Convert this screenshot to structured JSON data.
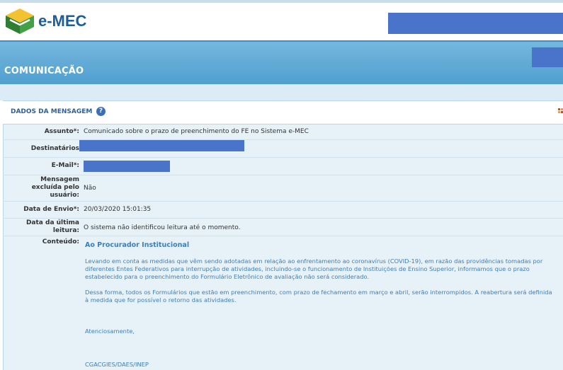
{
  "header": {
    "brand": "e-MEC",
    "colors": {
      "brand": "#1f5d98",
      "band": "#5ba6d4",
      "redaction": "#4a74c9"
    }
  },
  "page": {
    "title": "COMUNICAÇÃO"
  },
  "panel": {
    "title": "DADOS DA MENSAGEM",
    "help_icon": "?",
    "fields": [
      {
        "label": "Assunto*:",
        "value": "Comunicado sobre o prazo de preenchimento do FE no Sistema e-MEC"
      },
      {
        "label": "Destinatários",
        "value": ""
      },
      {
        "label": "E-Mail*:",
        "value": ""
      },
      {
        "label_lines": [
          "Mensagem",
          "excluída pelo",
          "usuário:"
        ],
        "value": "Não"
      },
      {
        "label": "Data de Envio*:",
        "value": "20/03/2020 15:01:35"
      },
      {
        "label_lines": [
          "Data da última",
          "leitura:"
        ],
        "value": "O sistema não identificou leitura até o momento."
      },
      {
        "label": "Conteúdo:"
      }
    ]
  },
  "message": {
    "title": "Ao Procurador Institucional",
    "paragraph1_line1": "Levando em conta as medidas que vêm sendo adotadas em relação ao enfrentamento ao coronavírus (COVID-19), em razão das providências tomadas por",
    "paragraph1_line2": "diferentes Entes Federativos para interrupção de atividades, incluindo-se o funcionamento de Instituições de Ensino Superior, informamos que o prazo",
    "paragraph1_line3": "estabelecido para o preenchimento do Formulário Eletrônico de avaliação não será considerado.",
    "paragraph2_line1": "Dessa forma, todos os Formulários que estão em preenchimento, com prazo de fechamento em março e abril, serão interrompidos. A reabertura será definida",
    "paragraph2_line2": "à medida que for possível o retorno das atividades.",
    "closing": "Atenciosamente,",
    "signature": "CGACGIES/DAES/INEP"
  }
}
